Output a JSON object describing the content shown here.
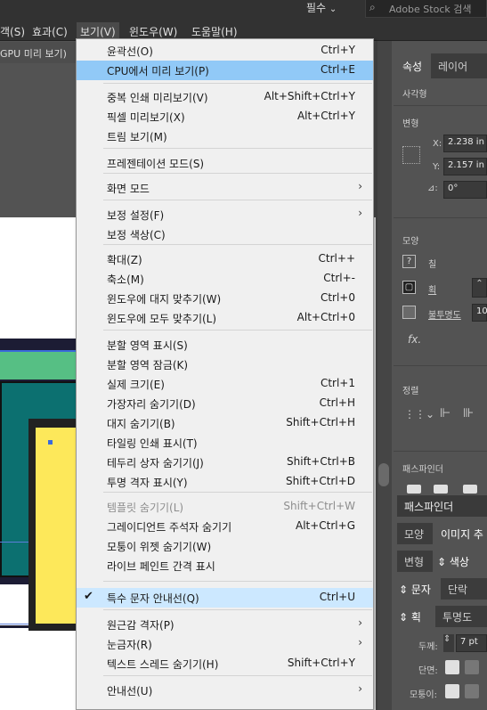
{
  "topbar": {
    "essentials_label": "필수",
    "search_placeholder": "Adobe Stock 검색"
  },
  "menubar": {
    "items": [
      "객(S)",
      "효과(C)",
      "보기(V)",
      "윈도우(W)",
      "도움말(H)"
    ]
  },
  "document_tab": {
    "label": "GPU 미리 보기)"
  },
  "panel": {
    "tabs": [
      "속성",
      "레이어"
    ],
    "section_rect": "사각형",
    "section_transform": "변형",
    "x_label": "X:",
    "x_value": "2.238 in",
    "y_label": "Y:",
    "y_value": "2.157 in",
    "angle_value": "0°",
    "section_appearance": "모양",
    "fill_label": "칠",
    "stroke_label": "획",
    "opacity_label": "불투명도",
    "opacity_value": "10",
    "fx_label": "fx.",
    "section_align": "정렬",
    "section_pathfinder": "패스파인더",
    "docked_tab_pathfinder": "패스파인더",
    "docked_tabs_row1": [
      "모양",
      "이미지 추"
    ],
    "docked_tabs_row2": [
      "변형",
      "색상"
    ],
    "docked_tabs_row3": [
      "문자",
      "단락"
    ],
    "docked_tabs_row4": [
      "획",
      "투명도"
    ],
    "weight_label": "두께:",
    "weight_value": "7 pt",
    "cap_label": "단면:",
    "corner_label": "모퉁이:"
  },
  "menu": {
    "items": [
      {
        "label": "윤곽선(O)",
        "shortcut": "Ctrl+Y"
      },
      {
        "label": "CPU에서 미리 보기(P)",
        "shortcut": "Ctrl+E",
        "state": "highlighted"
      },
      {
        "label": "중복 인쇄 미리보기(V)",
        "shortcut": "Alt+Shift+Ctrl+Y"
      },
      {
        "label": "픽셀 미리보기(X)",
        "shortcut": "Alt+Ctrl+Y"
      },
      {
        "label": "트림 보기(M)",
        "shortcut": ""
      },
      {
        "label": "프레젠테이션 모드(S)",
        "shortcut": ""
      },
      {
        "label": "화면 모드",
        "shortcut": "",
        "submenu": true
      },
      {
        "label": "보정 설정(F)",
        "shortcut": "",
        "submenu": true
      },
      {
        "label": "보정 색상(C)",
        "shortcut": ""
      },
      {
        "label": "확대(Z)",
        "shortcut": "Ctrl++"
      },
      {
        "label": "축소(M)",
        "shortcut": "Ctrl+-"
      },
      {
        "label": "윈도우에 대지 맞추기(W)",
        "shortcut": "Ctrl+0"
      },
      {
        "label": "윈도우에 모두 맞추기(L)",
        "shortcut": "Alt+Ctrl+0"
      },
      {
        "label": "분할 영역 표시(S)",
        "shortcut": ""
      },
      {
        "label": "분할 영역 잠금(K)",
        "shortcut": ""
      },
      {
        "label": "실제 크기(E)",
        "shortcut": "Ctrl+1"
      },
      {
        "label": "가장자리 숨기기(D)",
        "shortcut": "Ctrl+H"
      },
      {
        "label": "대지 숨기기(B)",
        "shortcut": "Shift+Ctrl+H"
      },
      {
        "label": "타일링 인쇄 표시(T)",
        "shortcut": ""
      },
      {
        "label": "테두리 상자 숨기기(J)",
        "shortcut": "Shift+Ctrl+B"
      },
      {
        "label": "투명 격자 표시(Y)",
        "shortcut": "Shift+Ctrl+D"
      },
      {
        "label": "템플릿 숨기기(L)",
        "shortcut": "Shift+Ctrl+W",
        "state": "disabled"
      },
      {
        "label": "그레이디언트 주석자 숨기기",
        "shortcut": "Alt+Ctrl+G"
      },
      {
        "label": "모퉁이 위젯 숨기기(W)",
        "shortcut": ""
      },
      {
        "label": "라이브 페인트 간격 표시",
        "shortcut": ""
      },
      {
        "label": "특수 문자 안내선(Q)",
        "shortcut": "Ctrl+U",
        "state": "checked"
      },
      {
        "label": "원근감 격자(P)",
        "shortcut": "",
        "submenu": true
      },
      {
        "label": "눈금자(R)",
        "shortcut": "",
        "submenu": true
      },
      {
        "label": "텍스트 스레드 숨기기(H)",
        "shortcut": "Shift+Ctrl+Y"
      },
      {
        "label": "안내선(U)",
        "shortcut": "",
        "submenu": true
      }
    ]
  }
}
